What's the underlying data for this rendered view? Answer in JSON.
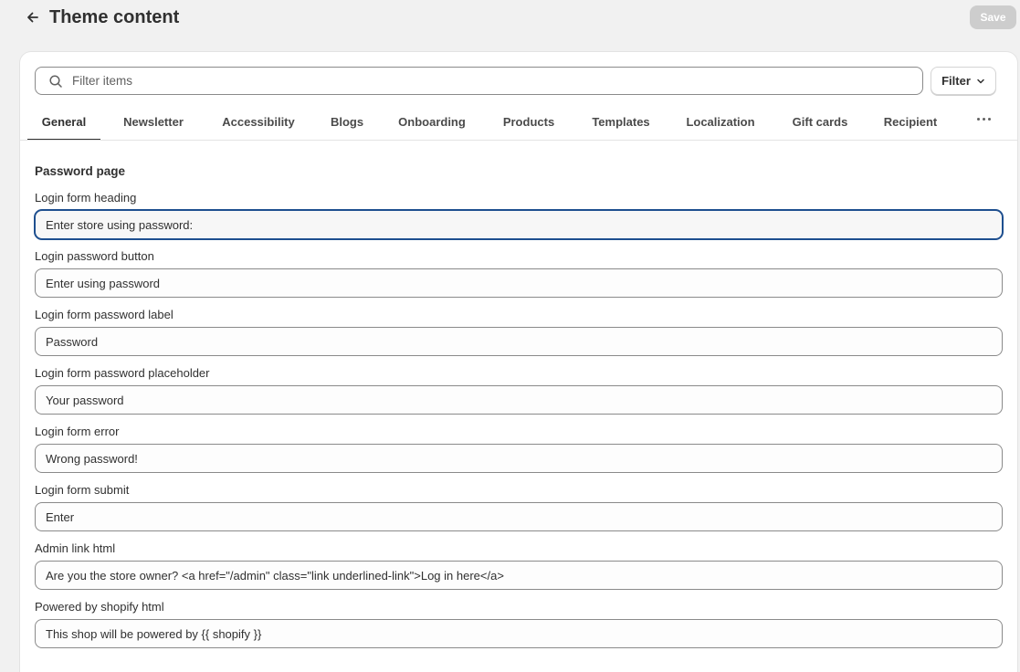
{
  "header": {
    "title": "Theme content",
    "save_label": "Save"
  },
  "search": {
    "placeholder": "Filter items",
    "filter_label": "Filter"
  },
  "tabs": [
    {
      "label": "General"
    },
    {
      "label": "Newsletter"
    },
    {
      "label": "Accessibility"
    },
    {
      "label": "Blogs"
    },
    {
      "label": "Onboarding"
    },
    {
      "label": "Products"
    },
    {
      "label": "Templates"
    },
    {
      "label": "Localization"
    },
    {
      "label": "Gift cards"
    },
    {
      "label": "Recipient"
    }
  ],
  "section": {
    "title": "Password page",
    "fields": [
      {
        "label": "Login form heading",
        "value": "Enter store using password:"
      },
      {
        "label": "Login password button",
        "value": "Enter using password"
      },
      {
        "label": "Login form password label",
        "value": "Password"
      },
      {
        "label": "Login form password placeholder",
        "value": "Your password"
      },
      {
        "label": "Login form error",
        "value": "Wrong password!"
      },
      {
        "label": "Login form submit",
        "value": "Enter"
      },
      {
        "label": "Admin link html",
        "value": "Are you the store owner? <a href=\"/admin\" class=\"link underlined-link\">Log in here</a>"
      },
      {
        "label": "Powered by shopify html",
        "value": "This shop will be powered by {{ shopify }}"
      }
    ]
  },
  "icons": {
    "back": "arrow-left-icon",
    "search": "search-icon",
    "filter_chevron": "chevron-down-icon",
    "more": "more-horizontal-icon"
  },
  "colors": {
    "background": "#f1f1f1",
    "text": "#303030",
    "focus_ring": "#1e4f8f",
    "save_disabled": "#cdcdcd"
  }
}
